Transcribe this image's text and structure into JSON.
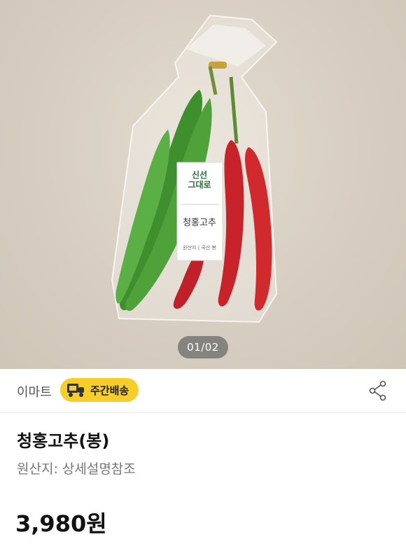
{
  "product_image": {
    "icon": "product-photo",
    "label_lines": [
      "신선",
      "그대로"
    ],
    "label_product_name": "청홍고추",
    "label_origin_line": "원산지 | 국산  봉",
    "counter": "01/02"
  },
  "seller": {
    "name": "이마트",
    "badge_label": "주간배송",
    "badge_color": "#f7cd2a",
    "share_icon": "share-icon"
  },
  "product": {
    "title": "청홍고추(봉)",
    "origin": "원산지: 상세설명참조",
    "price": "3,980원"
  }
}
